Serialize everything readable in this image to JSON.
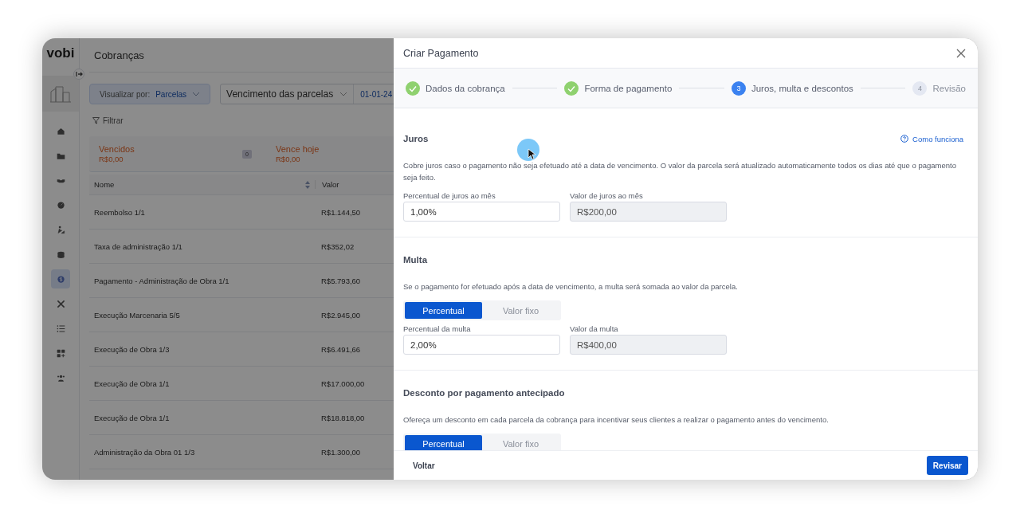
{
  "app": {
    "logo": "vobi",
    "page_title": "Cobranças"
  },
  "sidebar": {
    "items": [
      {
        "selected": false
      },
      {
        "selected": false
      },
      {
        "selected": false
      },
      {
        "selected": false
      },
      {
        "selected": false
      },
      {
        "selected": false
      },
      {
        "selected": true
      },
      {
        "selected": false
      },
      {
        "selected": false
      },
      {
        "selected": false
      },
      {
        "selected": false
      }
    ]
  },
  "toolbar": {
    "view_label": "Visualizar por:",
    "view_value": "Parcelas",
    "date_field": "Vencimento das parcelas",
    "date_start": "01-01-24",
    "filter": "Filtrar"
  },
  "summary": [
    {
      "label": "Vencidos",
      "amount": "R$0,00",
      "count": "0"
    },
    {
      "label": "Vence hoje",
      "amount": "R$0,00"
    }
  ],
  "table": {
    "columns": [
      "Nome",
      "Valor"
    ],
    "rows": [
      [
        "Reembolso 1/1",
        "R$1.144,50"
      ],
      [
        "Taxa de administração 1/1",
        "R$352,02"
      ],
      [
        "Pagamento - Administração de Obra 1/1",
        "R$5.793,60"
      ],
      [
        "Execução Marcenaria 5/5",
        "R$2.945,00"
      ],
      [
        "Execução de Obra 1/3",
        "R$6.491,66"
      ],
      [
        "Execução de Obra 1/1",
        "R$17.000,00"
      ],
      [
        "Execução de Obra 1/1",
        "R$18.818,00"
      ],
      [
        "Administração da Obra 01 1/3",
        "R$1.300,00"
      ]
    ]
  },
  "drawer": {
    "title": "Criar Pagamento",
    "steps": [
      {
        "label": "Dados da cobrança",
        "completed": true,
        "selected": false
      },
      {
        "label": "Forma de pagamento",
        "completed": true,
        "selected": false
      },
      {
        "label": "Juros, multa e descontos",
        "completed": false,
        "selected": true,
        "number": "3"
      },
      {
        "label": "Revisão",
        "completed": false,
        "selected": false,
        "number": "4"
      }
    ],
    "sections": [
      {
        "title": "Juros",
        "help_link": "Como funciona",
        "description": "Cobre juros caso o pagamento não seja efetuado até a data de vencimento. O valor da parcela será atualizado automaticamente todos os dias até que o pagamento seja feito.",
        "fields": [
          {
            "label": "Percentual de juros ao mês",
            "value": "1,00%",
            "readonly": false
          },
          {
            "label": "Valor de juros ao mês",
            "value": "R$200,00",
            "readonly": true
          }
        ]
      },
      {
        "title": "Multa",
        "description": "Se o pagamento for efetuado após a data de vencimento, a multa será somada ao valor da parcela.",
        "toggle": [
          {
            "label": "Percentual",
            "selected": true
          },
          {
            "label": "Valor fixo",
            "selected": false
          }
        ],
        "fields": [
          {
            "label": "Percentual da multa",
            "value": "2,00%",
            "readonly": false
          },
          {
            "label": "Valor da multa",
            "value": "R$400,00",
            "readonly": true
          }
        ]
      },
      {
        "title": "Desconto por pagamento antecipado",
        "description": "Ofereça um desconto em cada parcela da cobrança para incentivar seus clientes a realizar o pagamento antes do vencimento.",
        "toggle": [
          {
            "label": "Percentual",
            "selected": true
          },
          {
            "label": "Valor fixo",
            "selected": false
          }
        ]
      }
    ],
    "back_button": "Voltar",
    "next_button": "Revisar"
  }
}
